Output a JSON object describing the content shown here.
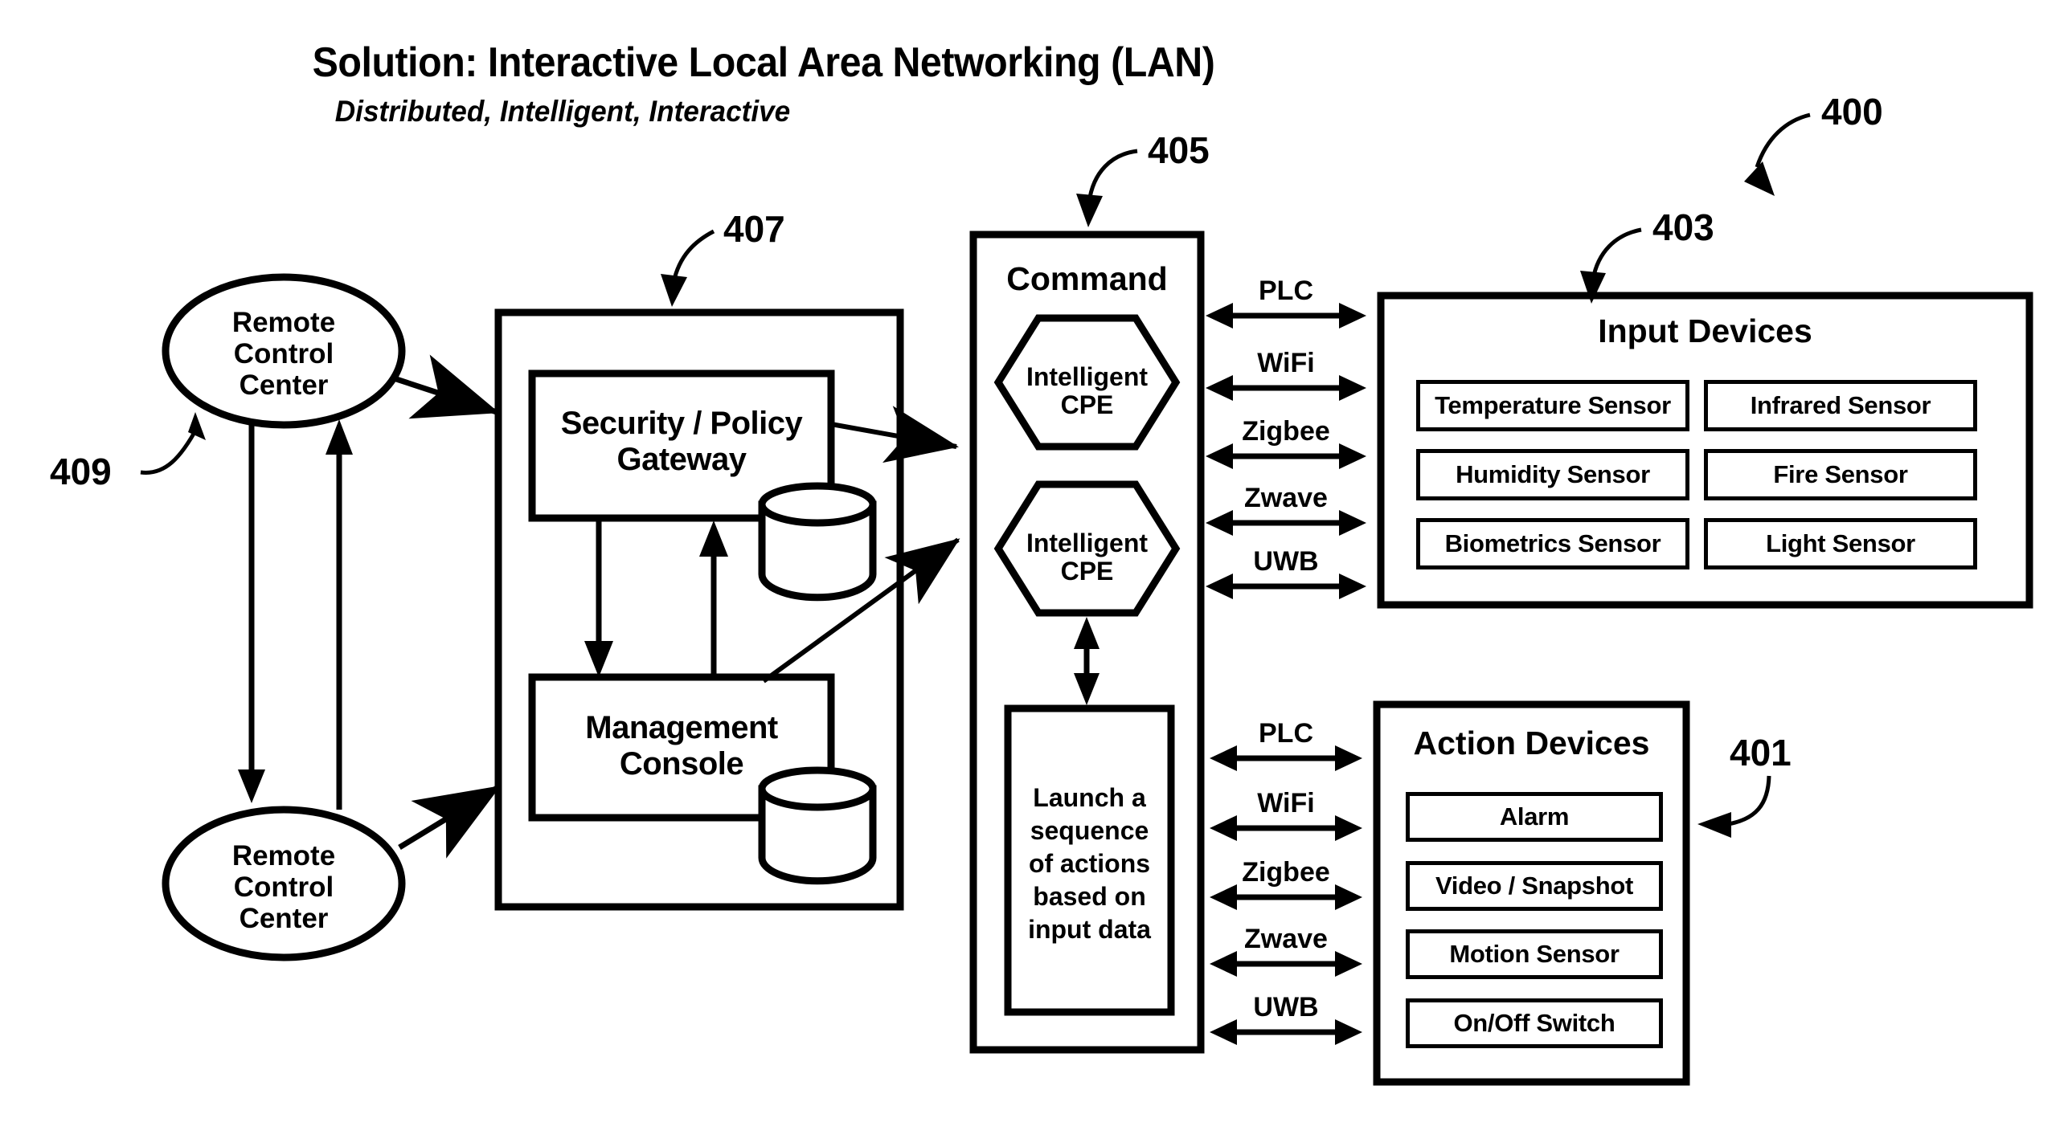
{
  "header": {
    "title": "Solution: Interactive Local Area Networking (LAN)",
    "subtitle": "Distributed, Intelligent, Interactive"
  },
  "reference_numbers": {
    "system": "400",
    "input_devices": "403",
    "action_devices": "401",
    "command": "405",
    "gateway_group": "407",
    "remote_control": "409"
  },
  "remote_centers": [
    {
      "label": "Remote\nControl\nCenter"
    },
    {
      "label": "Remote\nControl\nCenter"
    }
  ],
  "gateway_group": {
    "security_policy_gateway": "Security / Policy\nGateway",
    "management_console": "Management\nConsole",
    "database_icon": "database-cylinder"
  },
  "command": {
    "title": "Command",
    "cpe_nodes": [
      {
        "label": "Intelligent\nCPE"
      },
      {
        "label": "Intelligent\nCPE"
      }
    ],
    "launch_box": "Launch a\nsequence\nof actions\nbased on\ninput data"
  },
  "protocols_upper": [
    "PLC",
    "WiFi",
    "Zigbee",
    "Zwave",
    "UWB"
  ],
  "protocols_lower": [
    "PLC",
    "WiFi",
    "Zigbee",
    "Zwave",
    "UWB"
  ],
  "input_devices": {
    "title": "Input Devices",
    "items": [
      "Temperature Sensor",
      "Infrared Sensor",
      "Humidity Sensor",
      "Fire Sensor",
      "Biometrics Sensor",
      "Light Sensor"
    ]
  },
  "action_devices": {
    "title": "Action Devices",
    "items": [
      "Alarm",
      "Video / Snapshot",
      "Motion Sensor",
      "On/Off Switch"
    ]
  },
  "colors": {
    "line": "#000000",
    "background": "#ffffff"
  }
}
